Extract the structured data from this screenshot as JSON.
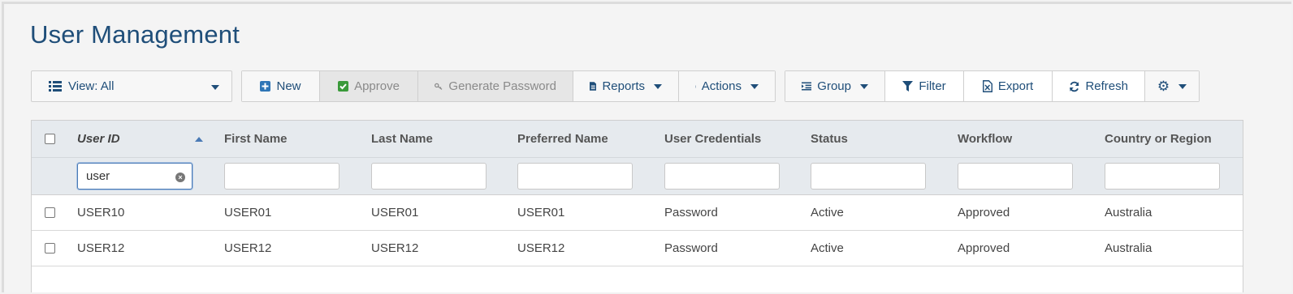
{
  "page": {
    "title": "User Management"
  },
  "view": {
    "label": "View: All"
  },
  "toolbar": {
    "new_label": "New",
    "approve_label": "Approve",
    "generate_password_label": "Generate Password",
    "reports_label": "Reports",
    "actions_label": "Actions",
    "group_label": "Group",
    "filter_label": "Filter",
    "export_label": "Export",
    "refresh_label": "Refresh"
  },
  "table": {
    "columns": [
      "User ID",
      "First Name",
      "Last Name",
      "Preferred Name",
      "User Credentials",
      "Status",
      "Workflow",
      "Country or Region"
    ],
    "sorted_column": "User ID",
    "sort_direction": "ascending",
    "filters": {
      "user_id": "user",
      "first_name": "",
      "last_name": "",
      "preferred_name": "",
      "credentials": "",
      "status": "",
      "workflow": "",
      "country": ""
    },
    "rows": [
      [
        "USER10",
        "USER01",
        "USER01",
        "USER01",
        "Password",
        "Active",
        "Approved",
        "Australia"
      ],
      [
        "USER12",
        "USER12",
        "USER12",
        "USER12",
        "Password",
        "Active",
        "Approved",
        "Australia"
      ]
    ]
  },
  "colors": {
    "accent": "#1f4e79",
    "header_bg": "#e6eaee",
    "approve_check": "#3a9a3a",
    "new_plus": "#2e75b6"
  }
}
